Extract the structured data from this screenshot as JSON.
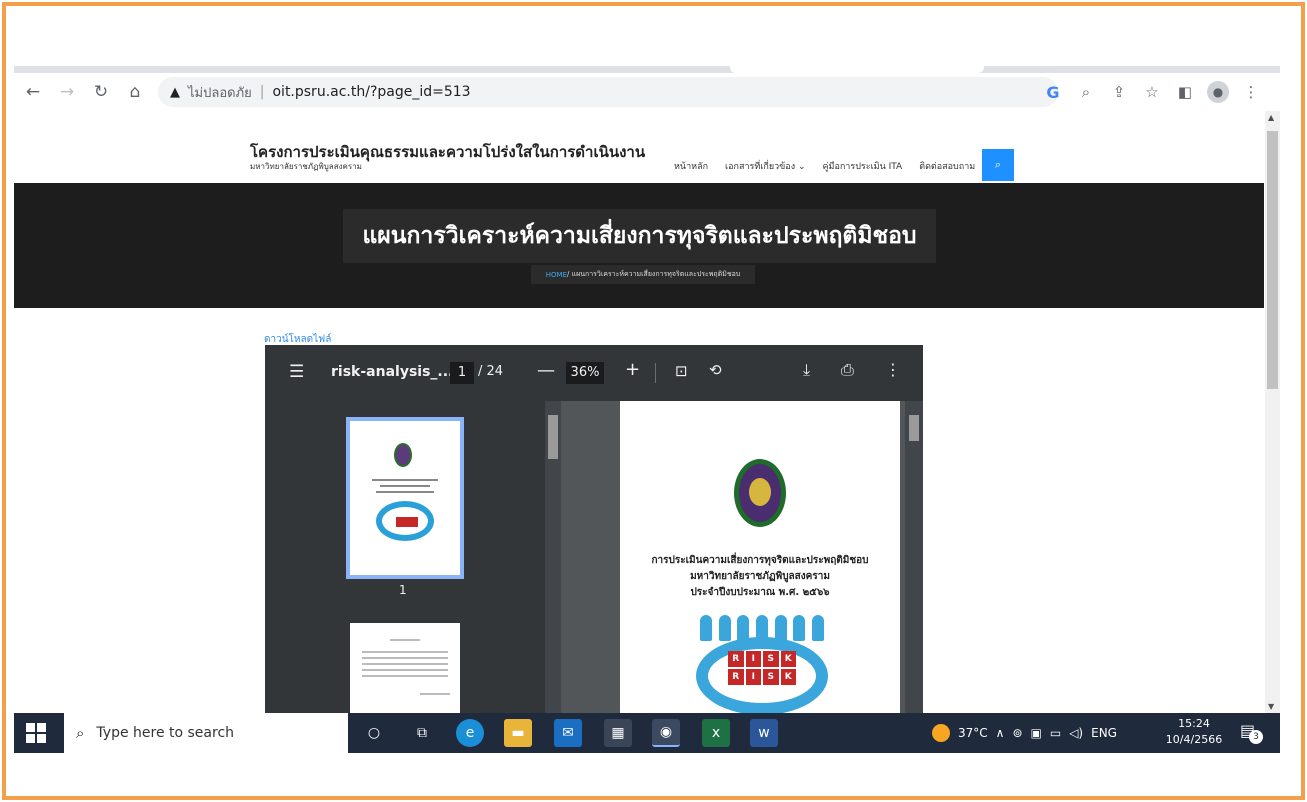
{
  "browser": {
    "security_warning": "ไม่ปลอดภัย",
    "separator": "|",
    "url": "oit.psru.ac.th/?page_id=513"
  },
  "site": {
    "title": "โครงการประเมินคุณธรรมและความโปร่งใสในการดำเนินงาน",
    "subtitle": "มหาวิทยาลัยราชภัฏพิบูลสงคราม",
    "menu": [
      "หน้าหลัก",
      "เอกสารที่เกี่ยวข้อง ⌄",
      "คู่มือการประเมิน ITA",
      "ติดต่อสอบถาม"
    ],
    "hero_title": "แผนการวิเคราะห์ความเสี่ยงการทุจริตและประพฤติมิชอบ",
    "breadcrumb_home": "HOME",
    "breadcrumb_current": " / แผนการวิเคราะห์ความเสี่ยงการทุจริตและประพฤติมิชอบ",
    "download_link": "ดาวน์โหลดไฟล์"
  },
  "pdf": {
    "file_name": "risk-analysis_...",
    "current_page": "1",
    "total_pages": "/ 24",
    "zoom": "36%",
    "thumbnail_label": "1",
    "page_lines": [
      "การประเมินความเสี่ยงการทุจริตและประพฤติมิชอบ",
      "มหาวิทยาลัยราชภัฏพิบูลสงคราม",
      "ประจำปีงบประมาณ พ.ศ. ๒๕๖๖"
    ],
    "risk_letters": [
      "R",
      "I",
      "S",
      "K",
      "R",
      "I",
      "S",
      "K"
    ]
  },
  "taskbar": {
    "search_placeholder": "Type here to search",
    "temperature": "37°C",
    "language": "ENG",
    "time": "15:24",
    "date": "10/4/2566",
    "notification_count": "3"
  },
  "colors": {
    "frame": "#f4a04a",
    "hero": "#1d1d1d",
    "accent": "#1e90ff",
    "taskbar": "#1f2a3c"
  }
}
